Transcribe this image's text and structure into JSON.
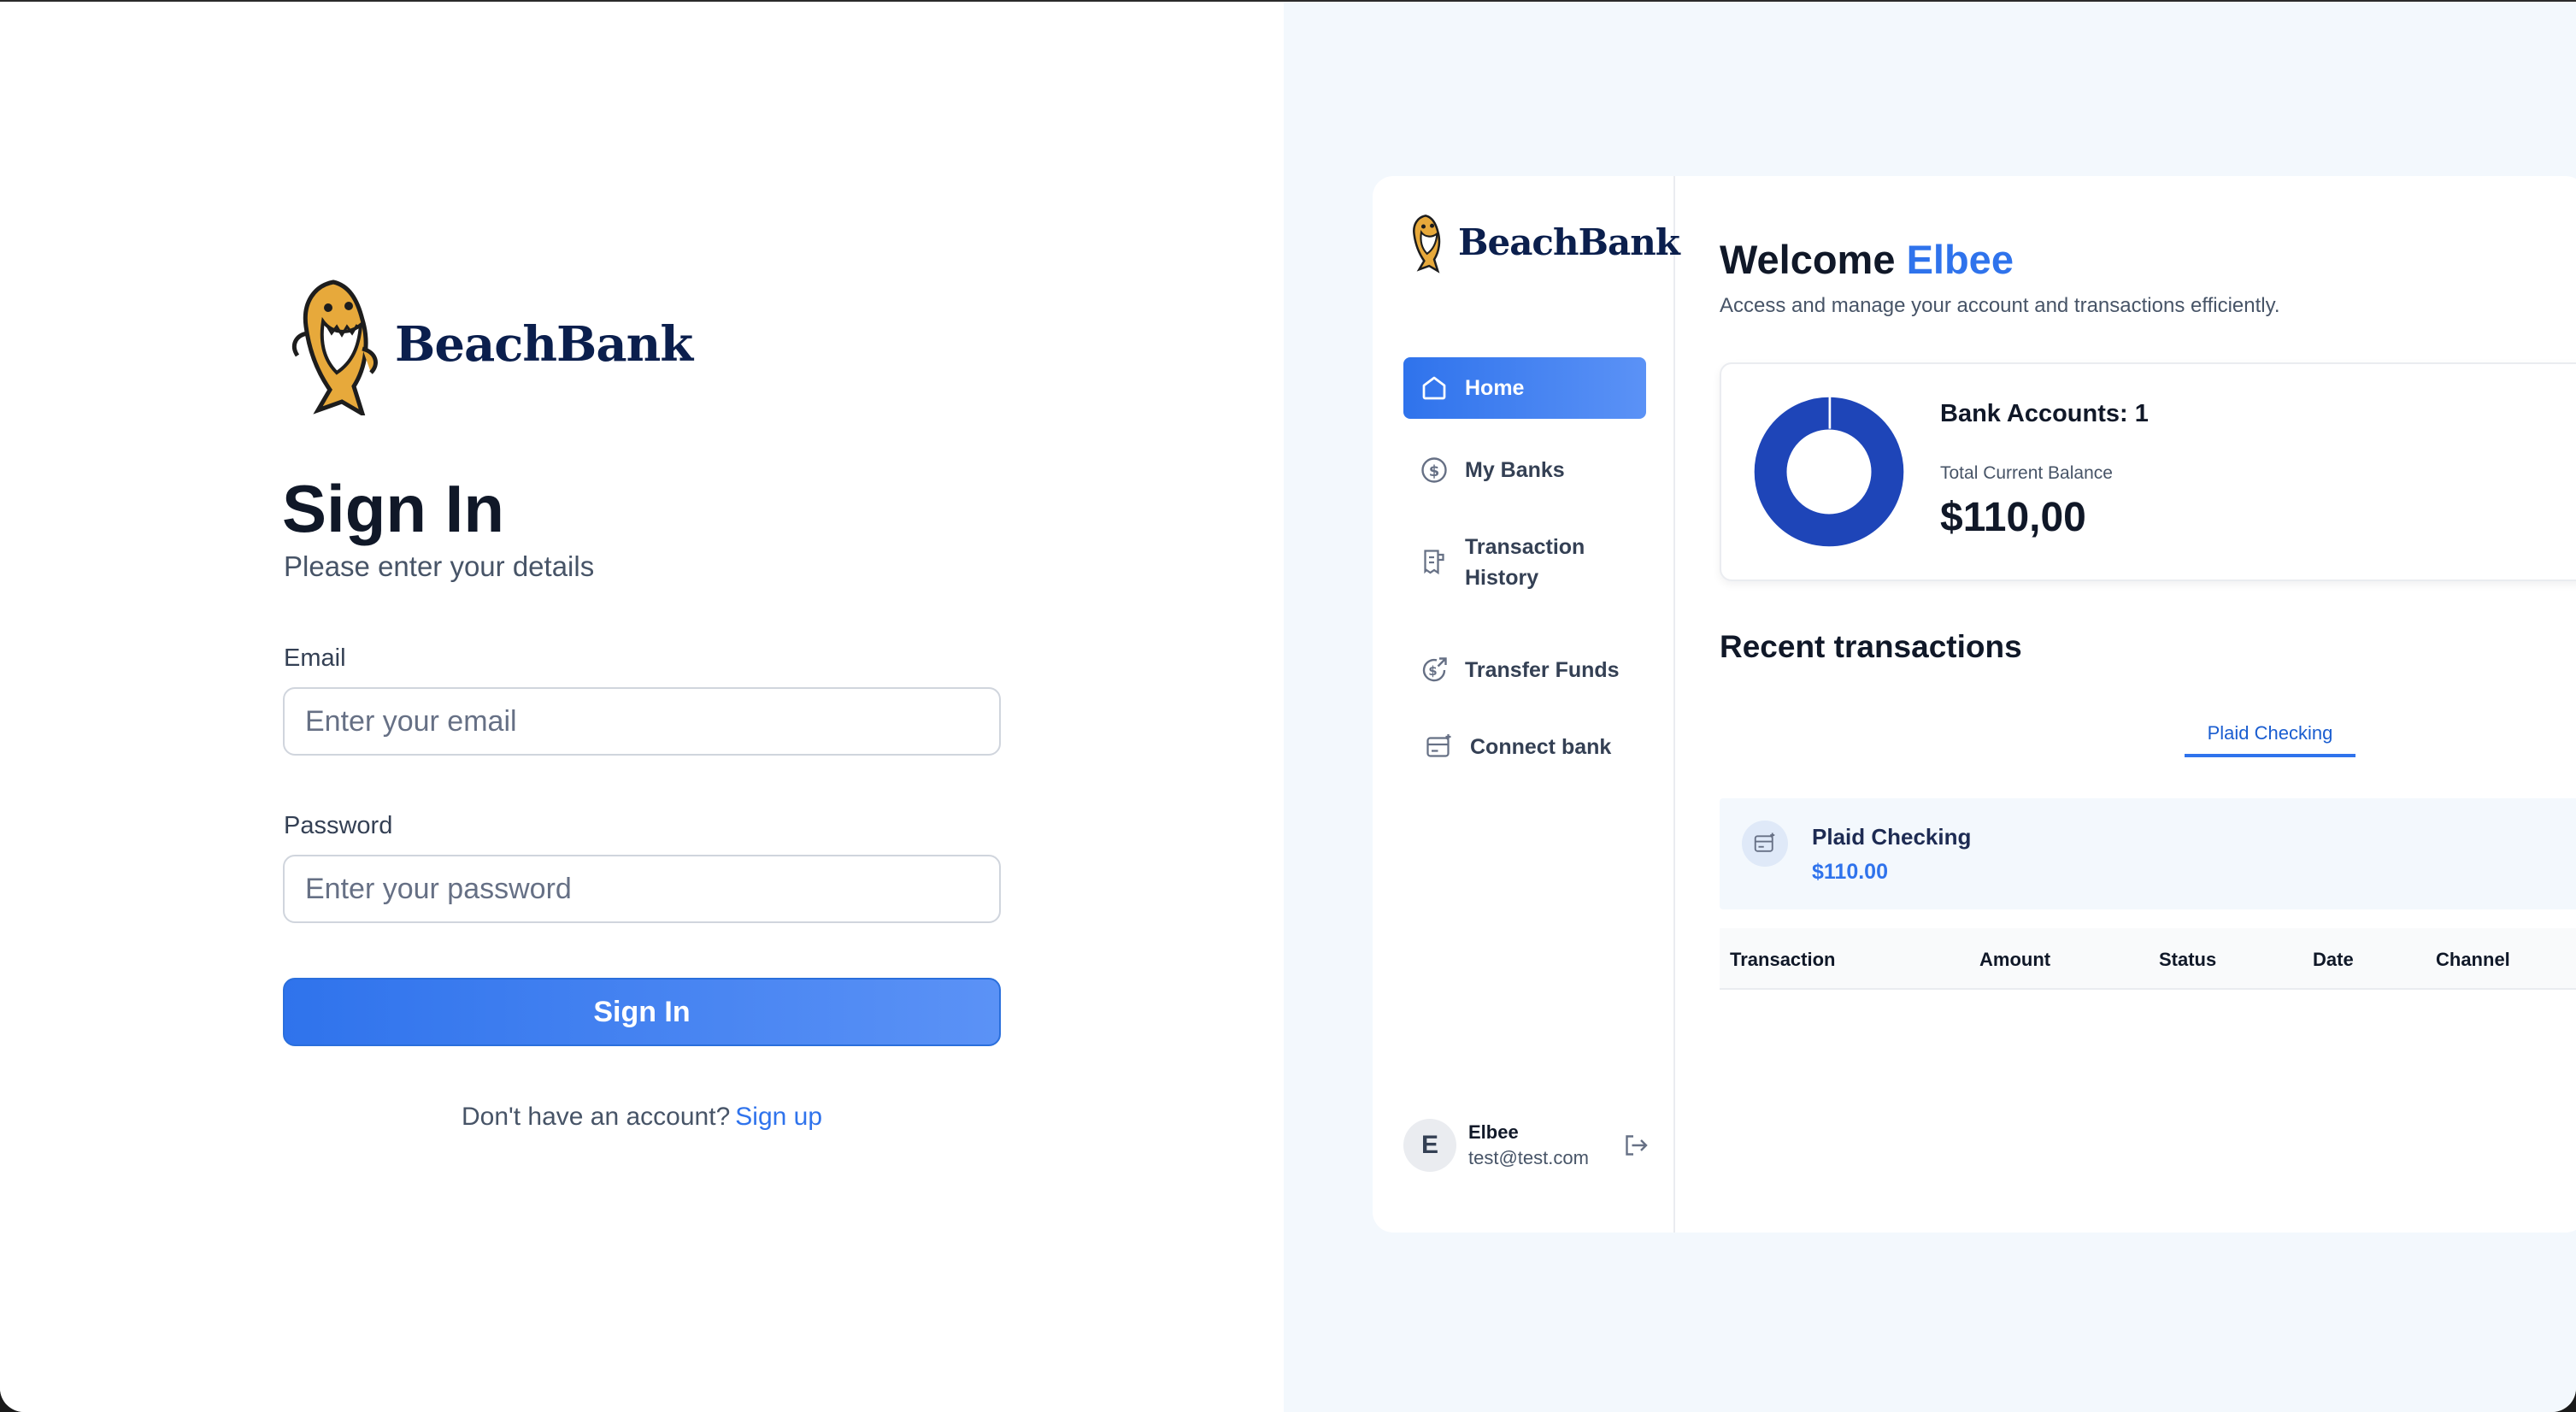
{
  "signin": {
    "brand_name": "BeachBank",
    "title": "Sign In",
    "subtitle": "Please enter your details",
    "email_label": "Email",
    "email_placeholder": "Enter your email",
    "password_label": "Password",
    "password_placeholder": "Enter your password",
    "submit_label": "Sign In",
    "signup_prompt": "Don't have an account?",
    "signup_link": "Sign up"
  },
  "preview": {
    "brand_name": "BeachBank",
    "nav": [
      {
        "label": "Home",
        "icon": "home-icon",
        "active": true
      },
      {
        "label": "My Banks",
        "icon": "dollar-circle-icon",
        "active": false
      },
      {
        "label": "Transaction History",
        "icon": "receipt-icon",
        "active": false
      },
      {
        "label": "Transfer Funds",
        "icon": "transfer-icon",
        "active": false
      },
      {
        "label": "Connect bank",
        "icon": "card-add-icon",
        "active": false
      }
    ],
    "user": {
      "initial": "E",
      "name": "Elbee",
      "email": "test@test.com"
    },
    "welcome_prefix": "Welcome",
    "welcome_name": "Elbee",
    "welcome_sub": "Access and manage your account and transactions efficiently.",
    "bank_accounts": "Bank Accounts: 1",
    "total_label": "Total Current Balance",
    "total_value": "$110,00",
    "recent_title": "Recent transactions",
    "tab_label": "Plaid Checking",
    "bank_card": {
      "name": "Plaid Checking",
      "amount": "$110.00"
    },
    "table_headers": [
      "Transaction",
      "Amount",
      "Status",
      "Date",
      "Channel"
    ]
  },
  "colors": {
    "accent": "#2f73ec",
    "brand_navy": "#0b1f4d",
    "donut": "#1e45b8",
    "panel_bg": "#f3f8fd"
  }
}
